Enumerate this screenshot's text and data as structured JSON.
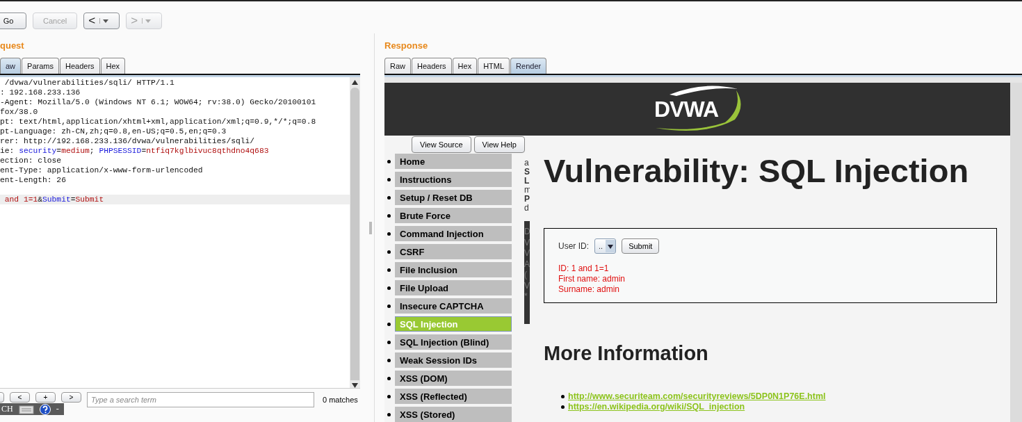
{
  "toolbar": {
    "buttons": [
      {
        "label": "Go",
        "kind": "text",
        "disabled": false
      },
      {
        "label": "Cancel",
        "kind": "text",
        "disabled": true
      },
      {
        "label": "<",
        "kind": "nav",
        "disabled": false
      },
      {
        "label": ">",
        "kind": "nav",
        "disabled": true
      }
    ]
  },
  "request": {
    "heading": "quest",
    "tabs": [
      {
        "label": "aw",
        "selected": true
      },
      {
        "label": "Params",
        "selected": false
      },
      {
        "label": "Headers",
        "selected": false
      },
      {
        "label": "Hex",
        "selected": false
      }
    ],
    "lines": [
      {
        "highlighted": false,
        "segments": [
          {
            "text": " /dvwa/vulnerabilities/sqli/ HTTP/1.1",
            "kind": "plain"
          }
        ]
      },
      {
        "highlighted": false,
        "segments": [
          {
            "text": ": 192.168.233.136",
            "kind": "plain"
          }
        ]
      },
      {
        "highlighted": false,
        "segments": [
          {
            "text": "-Agent: Mozilla/5.0 (Windows NT 6.1; WOW64; rv:38.0) Gecko/20100101",
            "kind": "plain"
          }
        ]
      },
      {
        "highlighted": false,
        "segments": [
          {
            "text": "fox/38.0",
            "kind": "plain"
          }
        ]
      },
      {
        "highlighted": false,
        "segments": [
          {
            "text": "pt: text/html,application/xhtml+xml,application/xml;q=0.9,*/*;q=0.8",
            "kind": "plain"
          }
        ]
      },
      {
        "highlighted": false,
        "segments": [
          {
            "text": "pt-Language: zh-CN,zh;q=0.8,en-US;q=0.5,en;q=0.3",
            "kind": "plain"
          }
        ]
      },
      {
        "highlighted": false,
        "segments": [
          {
            "text": "rer: http://192.168.233.136/dvwa/vulnerabilities/sqli/",
            "kind": "plain"
          }
        ]
      },
      {
        "highlighted": false,
        "segments": [
          {
            "text": "ie: ",
            "kind": "plain"
          },
          {
            "text": "security",
            "kind": "name"
          },
          {
            "text": "=",
            "kind": "plain"
          },
          {
            "text": "medium",
            "kind": "value"
          },
          {
            "text": "; ",
            "kind": "plain"
          },
          {
            "text": "PHPSESSID",
            "kind": "name"
          },
          {
            "text": "=",
            "kind": "plain"
          },
          {
            "text": "ntfiq7kglbivuc8qthdno4q683",
            "kind": "value"
          }
        ]
      },
      {
        "highlighted": false,
        "segments": [
          {
            "text": "ection: close",
            "kind": "plain"
          }
        ]
      },
      {
        "highlighted": false,
        "segments": [
          {
            "text": "ent-Type: application/x-www-form-urlencoded",
            "kind": "plain"
          }
        ]
      },
      {
        "highlighted": false,
        "segments": [
          {
            "text": "ent-Length: 26",
            "kind": "plain"
          }
        ]
      },
      {
        "highlighted": false
      },
      {
        "highlighted": true,
        "segments": [
          {
            "text": " and 1=1",
            "kind": "value"
          },
          {
            "text": "&",
            "kind": "plain"
          },
          {
            "text": "Submit",
            "kind": "name"
          },
          {
            "text": "=",
            "kind": "plain"
          },
          {
            "text": "Submit",
            "kind": "value"
          }
        ]
      }
    ],
    "search": {
      "buttons": [
        "<",
        "+",
        ">"
      ],
      "placeholder": "Type a search term",
      "matches": "0 matches"
    },
    "ime_bar": {
      "language": "CH",
      "minimize": "-"
    }
  },
  "response": {
    "heading": "Response",
    "tabs": [
      {
        "label": "Raw",
        "selected": false
      },
      {
        "label": "Headers",
        "selected": false
      },
      {
        "label": "Hex",
        "selected": false
      },
      {
        "label": "HTML",
        "selected": false
      },
      {
        "label": "Render",
        "selected": true
      }
    ],
    "page": {
      "logo": "DVWA",
      "overlay_buttons": [
        "View Source",
        "View Help"
      ],
      "menu": [
        {
          "label": "Home",
          "selected": false
        },
        {
          "label": "Instructions",
          "selected": false
        },
        {
          "label": "Setup / Reset DB",
          "selected": false
        },
        {
          "label": "Brute Force",
          "selected": false
        },
        {
          "label": "Command Injection",
          "selected": false
        },
        {
          "label": "CSRF",
          "selected": false
        },
        {
          "label": "File Inclusion",
          "selected": false
        },
        {
          "label": "File Upload",
          "selected": false
        },
        {
          "label": "Insecure CAPTCHA",
          "selected": false
        },
        {
          "label": "SQL Injection",
          "selected": true
        },
        {
          "label": "SQL Injection (Blind)",
          "selected": false
        },
        {
          "label": "Weak Session IDs",
          "selected": false
        },
        {
          "label": "XSS (DOM)",
          "selected": false
        },
        {
          "label": "XSS (Reflected)",
          "selected": false
        },
        {
          "label": "XSS (Stored)",
          "selected": false
        }
      ],
      "clipped_text": [
        "a",
        "S",
        "L",
        "m",
        "P",
        "d"
      ],
      "clipped_dark_text": [
        "D",
        "V",
        "V",
        "A",
        "(",
        "V",
        "*"
      ],
      "title": "Vulnerability: SQL Injection",
      "form": {
        "label": "User ID:",
        "select_value": "..",
        "button": "Submit",
        "results": [
          "ID: 1 and 1=1",
          "First name: admin",
          "Surname: admin"
        ]
      },
      "more_heading": "More Information",
      "links": [
        "http://www.securiteam.com/securityreviews/5DP0N1P76E.html",
        "https://en.wikipedia.org/wiki/SQL_injection"
      ]
    }
  }
}
